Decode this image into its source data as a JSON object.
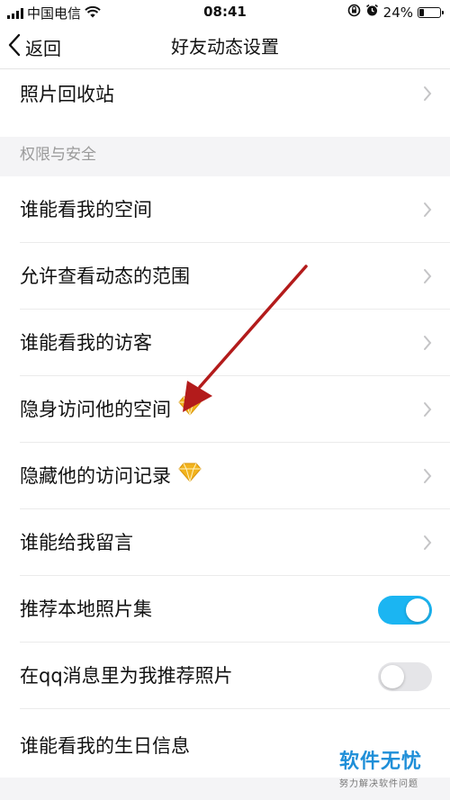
{
  "status_bar": {
    "carrier": "中国电信",
    "time": "08:41",
    "battery_percent": "24%",
    "battery_level": 0.24,
    "icons": [
      "signal-icon",
      "wifi-icon",
      "rotation-lock-icon",
      "alarm-icon",
      "battery-icon"
    ]
  },
  "nav": {
    "back_label": "返回",
    "title": "好友动态设置"
  },
  "rows_top": [
    {
      "label": "照片回收站",
      "control": "chevron"
    }
  ],
  "section": {
    "title": "权限与安全"
  },
  "rows": [
    {
      "label": "谁能看我的空间",
      "control": "chevron",
      "badge": null
    },
    {
      "label": "允许查看动态的范围",
      "control": "chevron",
      "badge": null
    },
    {
      "label": "谁能看我的访客",
      "control": "chevron",
      "badge": null
    },
    {
      "label": "隐身访问他的空间",
      "control": "chevron",
      "badge": "diamond-icon"
    },
    {
      "label": "隐藏他的访问记录",
      "control": "chevron",
      "badge": "diamond-icon"
    },
    {
      "label": "谁能给我留言",
      "control": "chevron",
      "badge": null
    },
    {
      "label": "推荐本地照片集",
      "control": "toggle",
      "on": true
    },
    {
      "label": "在qq消息里为我推荐照片",
      "control": "toggle",
      "on": false
    },
    {
      "label": "谁能看我的生日信息",
      "control": "chevron",
      "badge": null
    }
  ],
  "colors": {
    "accent": "#1bb5f2",
    "annotation_arrow": "#b31b1b",
    "watermark": "#1f8fd8"
  },
  "watermark": {
    "main": "软件无忧",
    "sub": "努力解决软件问题"
  }
}
